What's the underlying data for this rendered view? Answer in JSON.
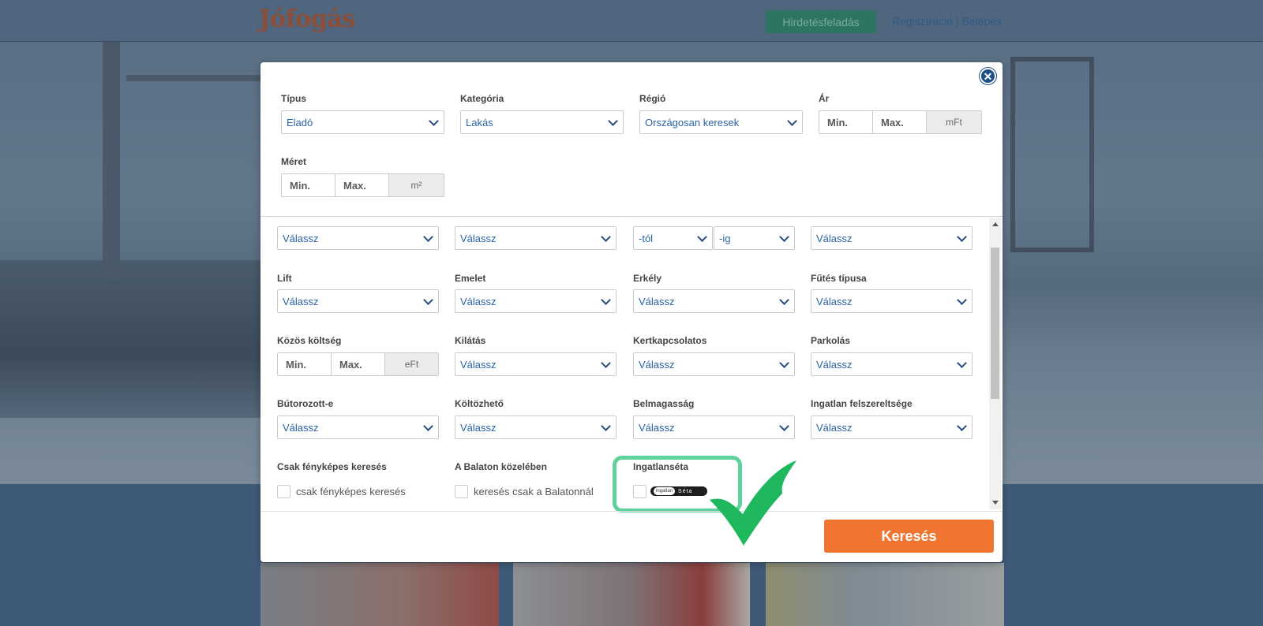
{
  "header": {
    "logo": "Jófogás",
    "post_ad_button": "Hirdetésfeladás",
    "register": "Regisztráció",
    "separator": " | ",
    "login": "Belépés"
  },
  "modal": {
    "close_icon": "close-icon",
    "top_fields": {
      "tipus": {
        "label": "Típus",
        "value": "Eladó"
      },
      "kategoria": {
        "label": "Kategória",
        "value": "Lakás"
      },
      "regio": {
        "label": "Régió",
        "value": "Országosan keresek"
      },
      "ar": {
        "label": "Ár",
        "min": "Min.",
        "max": "Max.",
        "unit": "mFt"
      },
      "meret": {
        "label": "Méret",
        "min": "Min.",
        "max": "Max.",
        "unit": "m²"
      }
    },
    "row0": {
      "a": "Válassz",
      "b": "Válassz",
      "c_from": "-tól",
      "c_to": "-ig",
      "d": "Válassz"
    },
    "row1": {
      "lift": {
        "label": "Lift",
        "value": "Válassz"
      },
      "emelet": {
        "label": "Emelet",
        "value": "Válassz"
      },
      "erkely": {
        "label": "Erkély",
        "value": "Válassz"
      },
      "futes": {
        "label": "Fűtés típusa",
        "value": "Válassz"
      }
    },
    "row2": {
      "kozos": {
        "label": "Közös költség",
        "min": "Min.",
        "max": "Max.",
        "unit": "eFt"
      },
      "kilatas": {
        "label": "Kilátás",
        "value": "Válassz"
      },
      "kert": {
        "label": "Kertkapcsolatos",
        "value": "Válassz"
      },
      "parkolas": {
        "label": "Parkolás",
        "value": "Válassz"
      }
    },
    "row3": {
      "butor": {
        "label": "Bútorozott-e",
        "value": "Válassz"
      },
      "koltoz": {
        "label": "Költözhető",
        "value": "Válassz"
      },
      "belmag": {
        "label": "Belmagasság",
        "value": "Válassz"
      },
      "felszer": {
        "label": "Ingatlan felszereltsége",
        "value": "Válassz"
      }
    },
    "row4": {
      "foto": {
        "label": "Csak fényképes keresés",
        "checkbox": "csak fényképes keresés"
      },
      "balaton": {
        "label": "A Balaton közelében",
        "checkbox": "keresés csak a Balatonnál"
      },
      "seta": {
        "label": "Ingatlanséta",
        "logo_text_1": "ingatlan",
        "logo_text_2": "Séta"
      }
    },
    "search_button": "Keresés"
  },
  "colors": {
    "accent_orange": "#ef7530",
    "link_blue": "#2a63a4",
    "highlight_green": "#5fd19a",
    "check_green": "#1fb85e"
  }
}
